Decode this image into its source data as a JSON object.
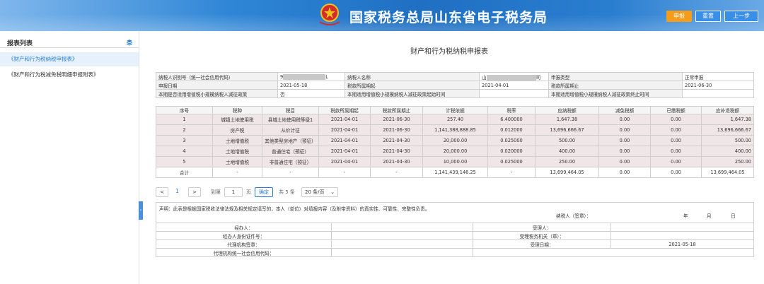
{
  "header": {
    "title": "国家税务总局山东省电子税务局",
    "buttons": {
      "submit": "申报",
      "reset": "重置",
      "prev": "上一步"
    },
    "colors": {
      "submit": "#f59c1a",
      "button": "#3a8ee6"
    }
  },
  "sidebar": {
    "title": "报表列表",
    "items": [
      {
        "label": "《财产和行为税纳税申报表》",
        "active": true
      },
      {
        "label": "《财产和行为税减免税明细申报附表》",
        "active": false
      }
    ]
  },
  "form": {
    "title": "财产和行为税纳税申报表",
    "info": {
      "taxpayer_id_label": "纳税人识别号（统一社会信用代码）",
      "taxpayer_id_prefix": "9",
      "taxpayer_id_suffix": "L",
      "taxpayer_name_label": "纳税人名称",
      "taxpayer_name_prefix": "山",
      "taxpayer_name_suffix": "司",
      "declare_type_label": "申报类型",
      "declare_type_value": "正常申报",
      "declare_date_label": "申报日期",
      "declare_date_value": "2021-05-18",
      "period_start_label": "税款所属期起",
      "period_start_value": "2021-04-01",
      "period_end_label": "税款所属期止",
      "period_end_value": "2021-06-30",
      "small_policy_label": "本期是否适用增值税小规模纳税人减征政策",
      "small_policy_value": "否",
      "policy_start_label": "本期适用增值税小规模纳税人减征政策起始时间",
      "policy_end_label": "本期适用增值税小规模纳税人减征政策终止时间"
    },
    "columns": [
      "序号",
      "税种",
      "税目",
      "税款所属期起",
      "税款所属期止",
      "计税依据",
      "税率",
      "应纳税额",
      "减免税额",
      "已缴税额",
      "应补退税额"
    ],
    "rows": [
      [
        "1",
        "城镇土地使用税",
        "县城土地使用税等级1",
        "2021-04-01",
        "2021-06-30",
        "257.40",
        "6.400000",
        "1,647.38",
        "0.00",
        "0.00",
        "1,647.38"
      ],
      [
        "2",
        "房产税",
        "从价计征",
        "2021-04-01",
        "2021-06-30",
        "1,141,388,888.85",
        "0.012000",
        "13,696,666.67",
        "0.00",
        "0.00",
        "13,696,666.67"
      ],
      [
        "3",
        "土地增值税",
        "其他类型房地产（预征）",
        "2021-04-01",
        "2021-04-30",
        "20,000.00",
        "0.025000",
        "500.00",
        "0.00",
        "0.00",
        "500.00"
      ],
      [
        "4",
        "土地增值税",
        "普通住宅（预征）",
        "2021-04-01",
        "2021-04-30",
        "20,000.00",
        "0.020000",
        "400.00",
        "0.00",
        "0.00",
        "400.00"
      ],
      [
        "5",
        "土地增值税",
        "非普通住宅（预征）",
        "2021-04-01",
        "2021-04-30",
        "10,000.00",
        "0.025000",
        "250.00",
        "0.00",
        "0.00",
        "250.00"
      ]
    ],
    "total_row": [
      "合计",
      "-",
      "-",
      "-",
      "-",
      "1,141,439,146.25",
      "-",
      "13,699,464.05",
      "0.00",
      "0.00",
      "13,699,464.05"
    ]
  },
  "pager": {
    "prev": "<",
    "current": "1",
    "next": ">",
    "goto_label": "到第",
    "goto_value": "1",
    "page_unit": "页",
    "confirm": "确定",
    "total": "共 5 条",
    "page_size": "20 条/页"
  },
  "declaration": {
    "statement": "声明：此表是根据国家税收法律法规及相关规定填写的，本人（单位）对填报内容（及附带资料）的真实性、可靠性、完整性负责。",
    "signer_label": "纳税人（签章）：",
    "year": "年",
    "month": "月",
    "day": "日",
    "handler_label": "经办人：",
    "handler_id_label": "经办人身份证件号：",
    "agency_seal_label": "代理机构签章：",
    "agency_code_label": "代理机构统一社会信用代码：",
    "receiver_label": "受理人：",
    "receiver_office_label": "受理税务机关（章）：",
    "receive_date_label": "受理日期：",
    "receive_date_value": "2021-05-18"
  }
}
